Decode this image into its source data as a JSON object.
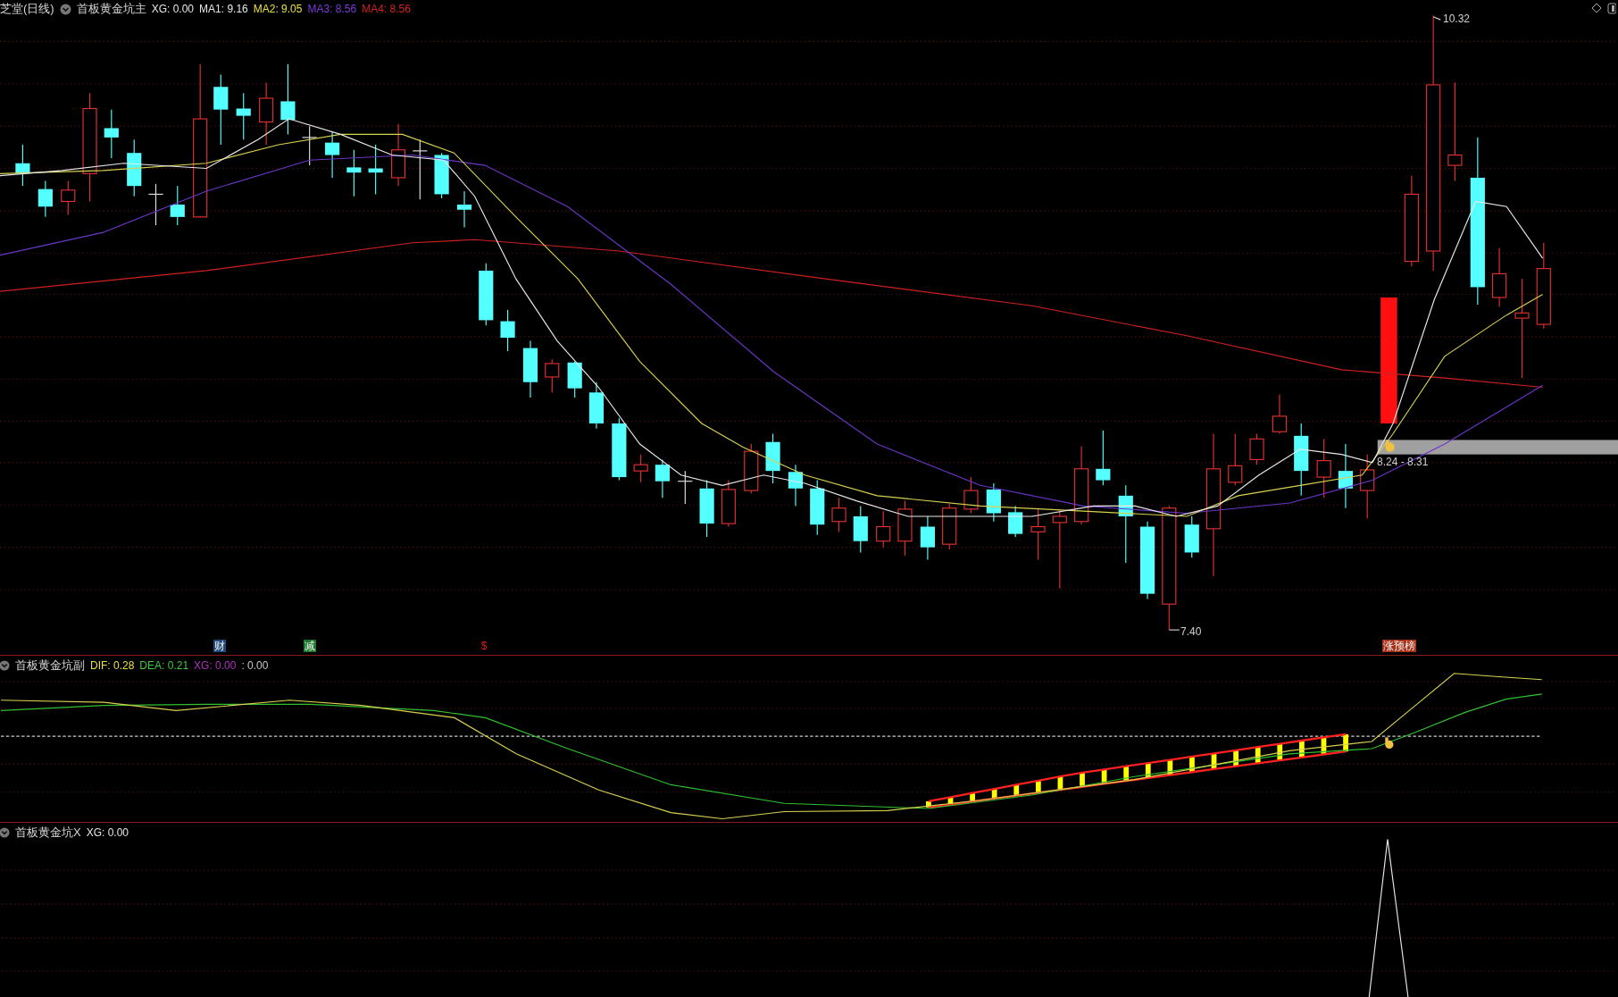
{
  "main_panel": {
    "title": "芝堂(日线)",
    "indicator": "首板黄金坑主",
    "values": [
      {
        "label": "XG: 0.00",
        "color": "#e6e6e6"
      },
      {
        "label": "MA1: 9.16",
        "color": "#e6e6e6"
      },
      {
        "label": "MA2: 9.05",
        "color": "#e8e040"
      },
      {
        "label": "MA3: 8.56",
        "color": "#7a3cd8"
      },
      {
        "label": "MA4: 8.56",
        "color": "#d02020"
      }
    ],
    "high_label": "10.32",
    "range_label": "8.24 - 8.31",
    "low_label": "7.40",
    "markers": [
      {
        "text": "财",
        "kind": "badge",
        "color": "#1f4a7a"
      },
      {
        "text": "减",
        "kind": "badge",
        "color": "#1a7a2a"
      },
      {
        "text": "$",
        "kind": "glyph",
        "color": "#e02020"
      },
      {
        "text": "涨预榜",
        "kind": "badge",
        "color": "#a83018"
      }
    ]
  },
  "sub_panel": {
    "indicator": "首板黄金坑副",
    "values": [
      {
        "label": "DIF: 0.28",
        "color": "#e8e040"
      },
      {
        "label": "DEA: 0.21",
        "color": "#3cc83c"
      },
      {
        "label": "XG: 0.00",
        "color": "#b030c0"
      },
      {
        "label": ": 0.00",
        "color": "#c8c8c8"
      }
    ]
  },
  "bottom_panel": {
    "indicator": "首板黄金坑X",
    "values": [
      {
        "label": "XG: 0.00",
        "color": "#e6e6e6"
      }
    ]
  }
}
